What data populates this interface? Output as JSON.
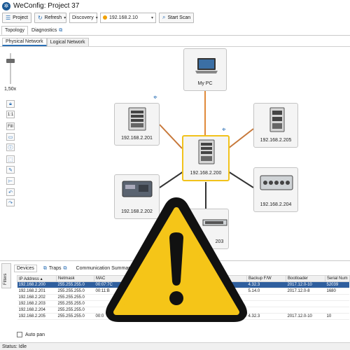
{
  "window": {
    "title": "WeConfig: Project 37"
  },
  "toolbar": {
    "project_label": "Project",
    "refresh_label": "Refresh",
    "discovery_label": "Discovery",
    "ip_value": "192.168.2.10",
    "start_scan_label": "Start Scan"
  },
  "tabs": [
    {
      "label": "Topology"
    },
    {
      "label": "Diagnostics"
    }
  ],
  "subtabs": [
    {
      "label": "Physical Network"
    },
    {
      "label": "Logical Network"
    }
  ],
  "zoom": {
    "label": "1,50x",
    "level": 0.8
  },
  "sidetools": [
    "1:1",
    "Fill"
  ],
  "nodes": {
    "mypc": {
      "label": "My PC",
      "icon": "laptop-icon"
    },
    "n201": {
      "label": "192.168.2.201",
      "icon": "switch-icon"
    },
    "n205": {
      "label": "192.168.2.205",
      "icon": "switch-icon"
    },
    "n200": {
      "label": "192.168.2.200",
      "icon": "switch-icon"
    },
    "n202": {
      "label": "192.168.2.202",
      "icon": "switch-icon"
    },
    "n204": {
      "label": "192.168.2.204",
      "icon": "switch-icon"
    },
    "n203": {
      "label": "203",
      "icon": "switch-icon"
    }
  },
  "links": {
    "pc_link": "#e08a3a",
    "copper": "#c7783a",
    "dark": "#333333"
  },
  "bottom": {
    "filters_label": "Filters",
    "tabs": [
      {
        "label": "Devices"
      },
      {
        "label": "Traps"
      },
      {
        "label": "Communication Summary"
      }
    ],
    "columns": [
      "IP Address",
      "Netmask",
      "MAC",
      "Backup F/W",
      "Bootloader",
      "Serial Num"
    ],
    "rows": [
      [
        "192.168.2.200",
        "255.255.255.0",
        "00:07:7C",
        "4.32.3",
        "2017.12.0-10",
        "52039"
      ],
      [
        "192.168.2.201",
        "255.255.255.0",
        "00:11:B",
        "5.14.0",
        "2017.12.0-8",
        "1680"
      ],
      [
        "192.168.2.202",
        "255.255.255.0",
        "",
        "",
        "",
        ""
      ],
      [
        "192.168.2.203",
        "255.255.255.0",
        "",
        "",
        "",
        ""
      ],
      [
        "192.168.2.204",
        "255.255.255.0",
        "",
        "",
        "",
        ""
      ],
      [
        "192.168.2.205",
        "255.255.255.0",
        "00:0",
        "4.32.3",
        "2017.12.0-10",
        "10"
      ]
    ],
    "autopan_label": "Auto pan"
  },
  "status": {
    "text": "Status: Idle"
  },
  "overlay": {
    "icon": "warning-icon",
    "fill": "#f5c518",
    "stroke": "#111111"
  }
}
